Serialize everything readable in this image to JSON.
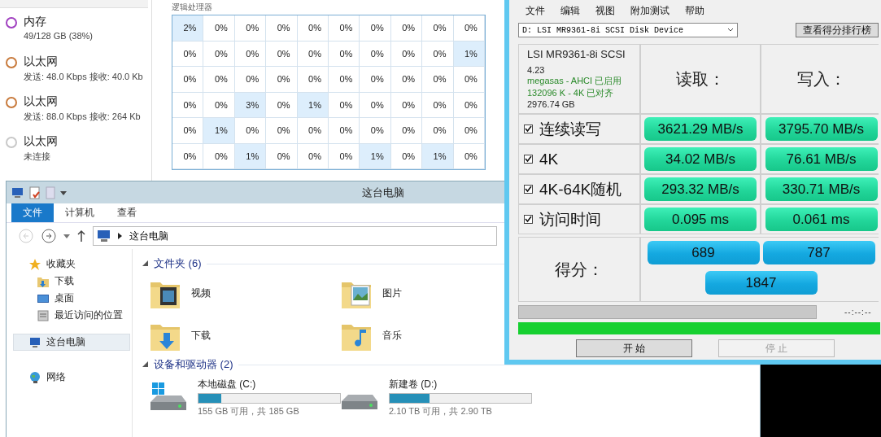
{
  "task_manager": {
    "resources": [
      {
        "name": "内存",
        "detail": "49/128 GB (38%)",
        "color": "#a040c0"
      },
      {
        "name": "以太网",
        "detail": "发送: 48.0 Kbps 接收: 40.0 Kb",
        "color": "#c87a3c"
      },
      {
        "name": "以太网",
        "detail": "发送: 88.0 Kbps 接收: 264 Kb",
        "color": "#c87a3c"
      },
      {
        "name": "以太网",
        "detail": "未连接",
        "color": "#c8c8c8"
      }
    ],
    "logical_processors": {
      "label": "逻辑处理器",
      "rows": [
        [
          {
            "value": "2%",
            "busy": true
          },
          {
            "value": "0%",
            "busy": false
          },
          {
            "value": "0%",
            "busy": false
          },
          {
            "value": "0%",
            "busy": false
          },
          {
            "value": "0%",
            "busy": false
          },
          {
            "value": "0%",
            "busy": false
          },
          {
            "value": "0%",
            "busy": false
          },
          {
            "value": "0%",
            "busy": false
          },
          {
            "value": "0%",
            "busy": false
          },
          {
            "value": "0%",
            "busy": false
          }
        ],
        [
          {
            "value": "0%",
            "busy": false
          },
          {
            "value": "0%",
            "busy": false
          },
          {
            "value": "0%",
            "busy": false
          },
          {
            "value": "0%",
            "busy": false
          },
          {
            "value": "0%",
            "busy": false
          },
          {
            "value": "0%",
            "busy": false
          },
          {
            "value": "0%",
            "busy": false
          },
          {
            "value": "0%",
            "busy": false
          },
          {
            "value": "0%",
            "busy": false
          },
          {
            "value": "1%",
            "busy": true
          }
        ],
        [
          {
            "value": "0%",
            "busy": false
          },
          {
            "value": "0%",
            "busy": false
          },
          {
            "value": "0%",
            "busy": false
          },
          {
            "value": "0%",
            "busy": false
          },
          {
            "value": "0%",
            "busy": false
          },
          {
            "value": "0%",
            "busy": false
          },
          {
            "value": "0%",
            "busy": false
          },
          {
            "value": "0%",
            "busy": false
          },
          {
            "value": "0%",
            "busy": false
          },
          {
            "value": "0%",
            "busy": false
          }
        ],
        [
          {
            "value": "0%",
            "busy": false
          },
          {
            "value": "0%",
            "busy": false
          },
          {
            "value": "3%",
            "busy": true
          },
          {
            "value": "0%",
            "busy": false
          },
          {
            "value": "1%",
            "busy": true
          },
          {
            "value": "0%",
            "busy": false
          },
          {
            "value": "0%",
            "busy": false
          },
          {
            "value": "0%",
            "busy": false
          },
          {
            "value": "0%",
            "busy": false
          },
          {
            "value": "0%",
            "busy": false
          }
        ],
        [
          {
            "value": "0%",
            "busy": false
          },
          {
            "value": "1%",
            "busy": true
          },
          {
            "value": "0%",
            "busy": false
          },
          {
            "value": "0%",
            "busy": false
          },
          {
            "value": "0%",
            "busy": false
          },
          {
            "value": "0%",
            "busy": false
          },
          {
            "value": "0%",
            "busy": false
          },
          {
            "value": "0%",
            "busy": false
          },
          {
            "value": "0%",
            "busy": false
          },
          {
            "value": "0%",
            "busy": false
          }
        ],
        [
          {
            "value": "0%",
            "busy": false
          },
          {
            "value": "0%",
            "busy": false
          },
          {
            "value": "1%",
            "busy": true
          },
          {
            "value": "0%",
            "busy": false
          },
          {
            "value": "0%",
            "busy": false
          },
          {
            "value": "0%",
            "busy": false
          },
          {
            "value": "1%",
            "busy": true
          },
          {
            "value": "0%",
            "busy": false
          },
          {
            "value": "1%",
            "busy": true
          },
          {
            "value": "0%",
            "busy": false
          }
        ]
      ]
    }
  },
  "benchmark": {
    "menu": [
      "文件",
      "编辑",
      "视图",
      "附加测试",
      "帮助"
    ],
    "drive_select": {
      "value": "D: LSI MR9361-8i SCSI Disk Device"
    },
    "ranking_button": "查看得分排行榜",
    "info": [
      {
        "text": "LSI MR9361-8i SCSI",
        "kind": "name"
      },
      {
        "text": "4.23",
        "kind": "plain"
      },
      {
        "text": "megasas - AHCI 已启用",
        "kind": "ok"
      },
      {
        "text": "132096 K - 4K 已对齐",
        "kind": "ok"
      },
      {
        "text": "2976.74 GB",
        "kind": "plain"
      }
    ],
    "read_header": "读取：",
    "write_header": "写入：",
    "tests": [
      {
        "name": "连续读写",
        "checked": true,
        "read": "3621.29 MB/s",
        "write": "3795.70 MB/s"
      },
      {
        "name": "4K",
        "checked": true,
        "read": "34.02 MB/s",
        "write": "76.61 MB/s"
      },
      {
        "name": "4K-64K随机",
        "checked": true,
        "read": "293.32 MB/s",
        "write": "330.71 MB/s"
      },
      {
        "name": "访问时间",
        "checked": true,
        "read": "0.095 ms",
        "write": "0.061 ms"
      }
    ],
    "score_label": "得分：",
    "scores": {
      "read": "689",
      "write": "787",
      "total": "1847"
    },
    "progress": {
      "level": 0,
      "time": "--:--:--"
    },
    "overall": {
      "level": 1
    },
    "buttons": [
      {
        "label": "开  始",
        "disabled": false
      },
      {
        "label": "停  止",
        "disabled": true
      }
    ]
  },
  "explorer": {
    "title": "这台电脑",
    "ribbon_tabs": [
      {
        "label": "文件",
        "selected": true
      },
      {
        "label": "计算机",
        "selected": false
      },
      {
        "label": "查看",
        "selected": false
      }
    ],
    "address": "这台电脑",
    "nav": [
      {
        "label": "收藏夹",
        "kind": "star",
        "selected": false,
        "children": [
          {
            "label": "下载",
            "kind": "download",
            "selected": false
          },
          {
            "label": "桌面",
            "kind": "desktop",
            "selected": false
          },
          {
            "label": "最近访问的位置",
            "kind": "recent",
            "selected": false
          }
        ]
      },
      {
        "label": "这台电脑",
        "kind": "computer",
        "selected": true
      },
      {
        "label": "网络",
        "kind": "network",
        "selected": false
      }
    ],
    "folders_header": "文件夹 (6)",
    "folders": [
      {
        "name": "视频",
        "kind": "video"
      },
      {
        "name": "图片",
        "kind": "pictures"
      },
      {
        "name": "下载",
        "kind": "downloads"
      },
      {
        "name": "音乐",
        "kind": "music"
      }
    ],
    "drives_header": "设备和驱动器 (2)",
    "drives": [
      {
        "name": "本地磁盘 (C:)",
        "kind": "system",
        "level": 0.16,
        "free": "155 GB 可用，共 185 GB"
      },
      {
        "name": "新建卷 (D:)",
        "kind": "data",
        "level": 0.28,
        "free": "2.10 TB 可用，共 2.90 TB"
      }
    ]
  }
}
